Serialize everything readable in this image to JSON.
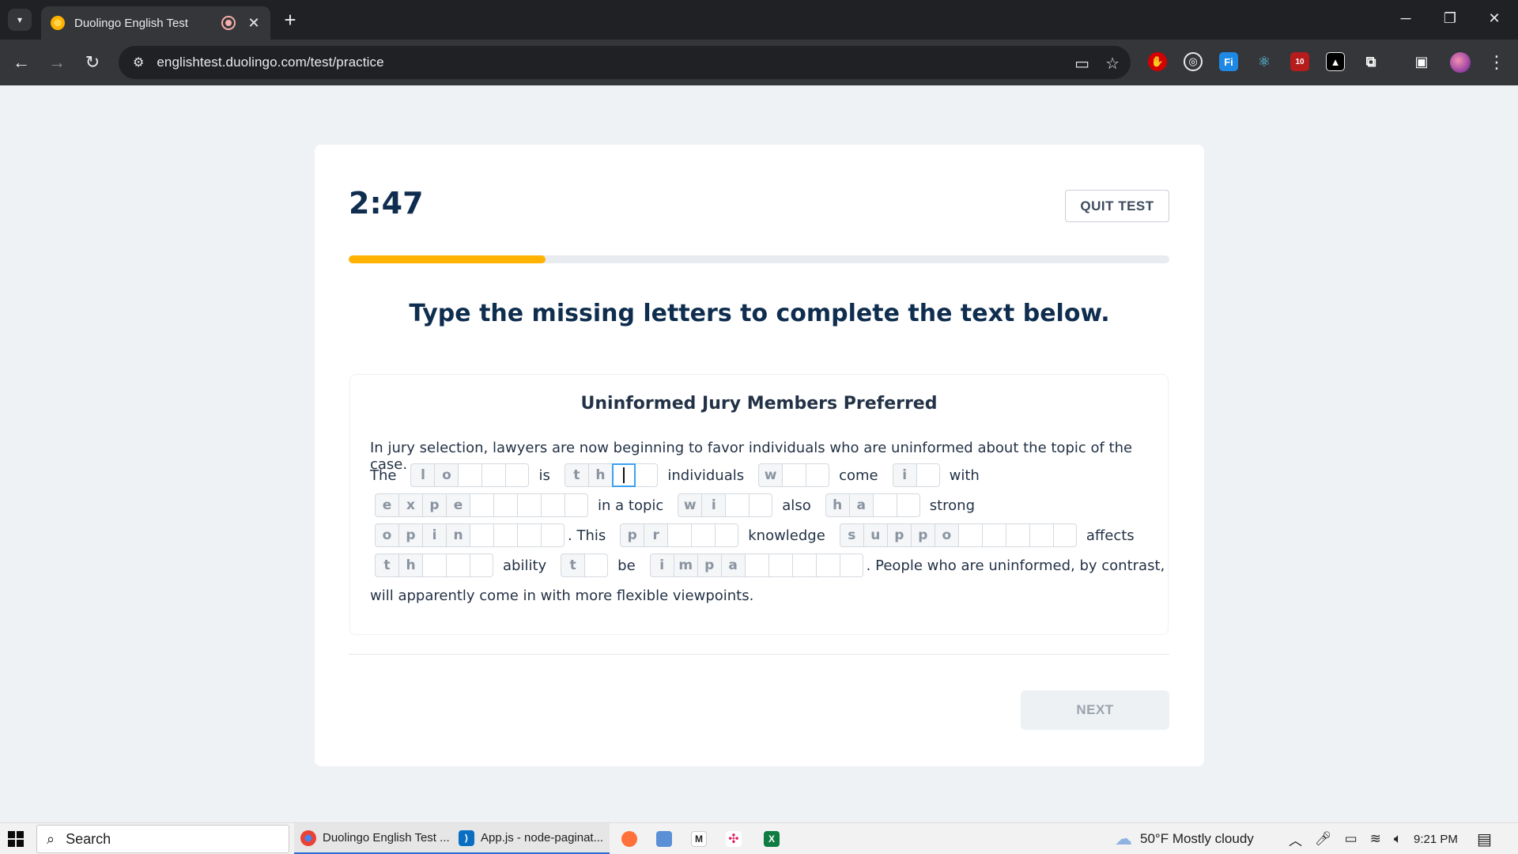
{
  "browser": {
    "tab_title": "Duolingo English Test",
    "new_tab": "+",
    "url": "englishtest.duolingo.com/test/practice",
    "extension_badge": "10"
  },
  "test": {
    "timer": "2:47",
    "quit_label": "QUIT TEST",
    "progress": 0.24,
    "instruction": "Type the missing letters to complete the text below.",
    "passage_title": "Uninformed Jury Members Preferred",
    "lead_sentence": "In jury selection, lawyers are now beginning to favor individuals who are uninformed about the topic of the case.",
    "words": {
      "the": "The",
      "is": "is",
      "individuals": "individuals",
      "come": "come",
      "with": "with",
      "in_a_topic": "in a topic",
      "also": "also",
      "strong": "strong",
      "this": ". This",
      "knowledge": "knowledge",
      "affects": "affects",
      "ability": "ability",
      "be": "be",
      "people_tail": ". People who are uninformed, by contrast,",
      "final_line": "will apparently come in with more flexible viewpoints."
    },
    "gaps": {
      "g1": [
        "l",
        "o",
        "",
        "",
        ""
      ],
      "g2": [
        "t",
        "h",
        "",
        ""
      ],
      "g3": [
        "w",
        "",
        ""
      ],
      "g4": [
        "i",
        ""
      ],
      "g5": [
        "e",
        "x",
        "p",
        "e",
        "",
        "",
        "",
        "",
        ""
      ],
      "g6": [
        "w",
        "i",
        "",
        ""
      ],
      "g7": [
        "h",
        "a",
        "",
        ""
      ],
      "g8": [
        "o",
        "p",
        "i",
        "n",
        "",
        "",
        "",
        ""
      ],
      "g9": [
        "p",
        "r",
        "",
        "",
        ""
      ],
      "g10": [
        "s",
        "u",
        "p",
        "p",
        "o",
        "",
        "",
        "",
        "",
        ""
      ],
      "g11": [
        "t",
        "h",
        "",
        "",
        ""
      ],
      "g12": [
        "t",
        ""
      ],
      "g13": [
        "i",
        "m",
        "p",
        "a",
        "",
        "",
        "",
        "",
        ""
      ]
    },
    "next_label": "NEXT"
  },
  "taskbar": {
    "search_placeholder": "Search",
    "app_chrome": "Duolingo English Test ...",
    "app_vscode": "App.js - node-paginat...",
    "weather": "50°F  Mostly cloudy",
    "time": "9:21 PM"
  }
}
